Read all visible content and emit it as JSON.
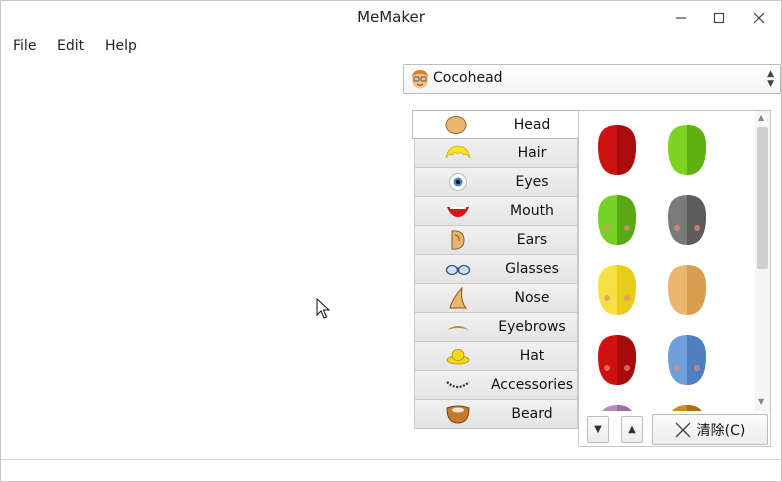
{
  "window": {
    "title": "MeMaker"
  },
  "menu": {
    "items": [
      "File",
      "Edit",
      "Help"
    ]
  },
  "profile": {
    "selected": "Cocohead",
    "icon": "cartoon-face-icon"
  },
  "categories": [
    {
      "label": "Head",
      "icon": "head-icon",
      "active": true
    },
    {
      "label": "Hair",
      "icon": "hair-icon"
    },
    {
      "label": "Eyes",
      "icon": "eye-icon"
    },
    {
      "label": "Mouth",
      "icon": "mouth-icon"
    },
    {
      "label": "Ears",
      "icon": "ear-icon"
    },
    {
      "label": "Glasses",
      "icon": "glasses-icon"
    },
    {
      "label": "Nose",
      "icon": "nose-icon"
    },
    {
      "label": "Eyebrows",
      "icon": "eyebrows-icon"
    },
    {
      "label": "Hat",
      "icon": "hat-icon"
    },
    {
      "label": "Accessories",
      "icon": "accessories-icon"
    },
    {
      "label": "Beard",
      "icon": "beard-icon"
    }
  ],
  "head_swatches": [
    {
      "color": "#cc1111",
      "shade": "#a80c0c",
      "cheeks": false
    },
    {
      "color": "#7ed321",
      "shade": "#5fb012",
      "cheeks": false
    },
    {
      "color": "#77d122",
      "shade": "#5aa814",
      "cheeks": true
    },
    {
      "color": "#7a7a7a",
      "shade": "#5c5c5c",
      "cheeks": true
    },
    {
      "color": "#f7e141",
      "shade": "#e8cc1c",
      "cheeks": true
    },
    {
      "color": "#e9b56f",
      "shade": "#d89d4f",
      "cheeks": false
    },
    {
      "color": "#d01010",
      "shade": "#a90b0b",
      "cheeks": true
    },
    {
      "color": "#6f9fd8",
      "shade": "#4f7fbf",
      "cheeks": true
    },
    {
      "color": "#b889c2",
      "shade": "#9c6ea8",
      "cheeks": false
    },
    {
      "color": "#d08a1a",
      "shade": "#b06f0c",
      "cheeks": false
    }
  ],
  "controls": {
    "scroll_down": "▼",
    "scroll_up": "▲",
    "clear_label": "清除(C)"
  }
}
